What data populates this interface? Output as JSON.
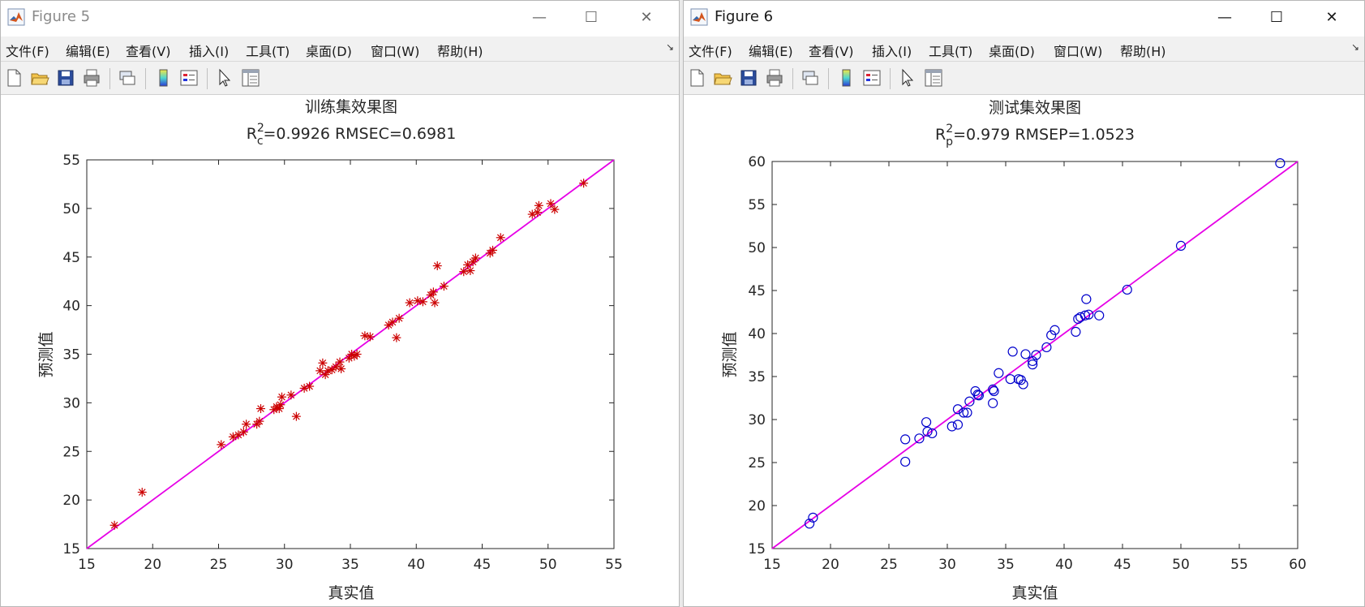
{
  "windows": [
    {
      "title": "Figure 5",
      "active": false,
      "menu": [
        "文件(F)",
        "编辑(E)",
        "查看(V)",
        "插入(I)",
        "工具(T)",
        "桌面(D)",
        "窗口(W)",
        "帮助(H)"
      ],
      "window_buttons": {
        "minimize": "—",
        "maximize": "☐",
        "close": "✕"
      },
      "menu_overflow": "↘",
      "plot": {
        "title": "训练集效果图",
        "subtitle": {
          "r": "R",
          "sup": "2",
          "sub": "c",
          "rest": "=0.9926  RMSEC=0.6981"
        },
        "xlabel": "真实值",
        "ylabel": "预测值"
      }
    },
    {
      "title": "Figure 6",
      "active": true,
      "menu": [
        "文件(F)",
        "编辑(E)",
        "查看(V)",
        "插入(I)",
        "工具(T)",
        "桌面(D)",
        "窗口(W)",
        "帮助(H)"
      ],
      "window_buttons": {
        "minimize": "—",
        "maximize": "☐",
        "close": "✕"
      },
      "menu_overflow": "↘",
      "plot": {
        "title": "测试集效果图",
        "subtitle": {
          "r": "R",
          "sup": "2",
          "sub": "p",
          "rest": "=0.979  RMSEP=1.0523"
        },
        "xlabel": "真实值",
        "ylabel": "预测值"
      }
    }
  ],
  "chart_data": [
    {
      "type": "scatter",
      "title": "训练集效果图",
      "subtitle": "R_c^2=0.9926  RMSEC=0.6981",
      "xlabel": "真实值",
      "ylabel": "预测值",
      "xlim": [
        15,
        55
      ],
      "ylim": [
        15,
        55
      ],
      "xticks": [
        15,
        20,
        25,
        30,
        35,
        40,
        45,
        50,
        55
      ],
      "yticks": [
        15,
        20,
        25,
        30,
        35,
        40,
        45,
        50,
        55
      ],
      "marker": "asterisk",
      "marker_color": "#cc0000",
      "line_color": "#e600e6",
      "fit_line": [
        [
          15,
          15
        ],
        [
          55,
          55
        ]
      ],
      "points": [
        [
          17.1,
          17.4
        ],
        [
          19.2,
          20.8
        ],
        [
          25.2,
          25.7
        ],
        [
          26.1,
          26.5
        ],
        [
          26.5,
          26.7
        ],
        [
          26.9,
          27.0
        ],
        [
          27.1,
          27.8
        ],
        [
          27.9,
          27.8
        ],
        [
          28.1,
          28.1
        ],
        [
          28.2,
          29.4
        ],
        [
          29.2,
          29.3
        ],
        [
          29.4,
          29.6
        ],
        [
          29.6,
          29.4
        ],
        [
          29.7,
          29.8
        ],
        [
          29.8,
          30.6
        ],
        [
          30.5,
          30.8
        ],
        [
          30.9,
          28.6
        ],
        [
          31.5,
          31.5
        ],
        [
          31.9,
          31.7
        ],
        [
          32.7,
          33.3
        ],
        [
          32.9,
          34.1
        ],
        [
          33.1,
          32.9
        ],
        [
          33.3,
          33.3
        ],
        [
          33.6,
          33.4
        ],
        [
          33.9,
          33.7
        ],
        [
          34.2,
          34.2
        ],
        [
          34.3,
          33.5
        ],
        [
          34.9,
          34.6
        ],
        [
          35.1,
          35.0
        ],
        [
          35.3,
          34.8
        ],
        [
          35.5,
          35.0
        ],
        [
          36.1,
          36.9
        ],
        [
          36.5,
          36.8
        ],
        [
          37.9,
          38.0
        ],
        [
          38.2,
          38.3
        ],
        [
          38.5,
          36.7
        ],
        [
          38.7,
          38.7
        ],
        [
          39.5,
          40.3
        ],
        [
          40.1,
          40.5
        ],
        [
          40.5,
          40.4
        ],
        [
          41.1,
          41.1
        ],
        [
          41.3,
          41.4
        ],
        [
          41.4,
          40.3
        ],
        [
          41.6,
          44.1
        ],
        [
          42.1,
          42.0
        ],
        [
          43.6,
          43.5
        ],
        [
          43.9,
          44.2
        ],
        [
          44.1,
          43.6
        ],
        [
          44.3,
          44.5
        ],
        [
          44.5,
          44.9
        ],
        [
          45.6,
          45.4
        ],
        [
          45.8,
          45.7
        ],
        [
          46.4,
          47.0
        ],
        [
          48.8,
          49.4
        ],
        [
          49.2,
          49.6
        ],
        [
          49.3,
          50.3
        ],
        [
          50.2,
          50.5
        ],
        [
          50.5,
          49.9
        ],
        [
          52.7,
          52.6
        ]
      ]
    },
    {
      "type": "scatter",
      "title": "测试集效果图",
      "subtitle": "R_p^2=0.979  RMSEP=1.0523",
      "xlabel": "真实值",
      "ylabel": "预测值",
      "xlim": [
        15,
        60
      ],
      "ylim": [
        15,
        60
      ],
      "xticks": [
        15,
        20,
        25,
        30,
        35,
        40,
        45,
        50,
        55,
        60
      ],
      "yticks": [
        15,
        20,
        25,
        30,
        35,
        40,
        45,
        50,
        55,
        60
      ],
      "marker": "circle",
      "marker_color": "#0000cc",
      "line_color": "#e600e6",
      "fit_line": [
        [
          15,
          15
        ],
        [
          60,
          60
        ]
      ],
      "points": [
        [
          18.2,
          17.9
        ],
        [
          18.5,
          18.6
        ],
        [
          26.4,
          27.7
        ],
        [
          26.4,
          25.1
        ],
        [
          27.6,
          27.8
        ],
        [
          28.2,
          29.7
        ],
        [
          28.3,
          28.6
        ],
        [
          28.7,
          28.4
        ],
        [
          30.4,
          29.2
        ],
        [
          30.9,
          31.2
        ],
        [
          30.9,
          29.4
        ],
        [
          31.4,
          30.8
        ],
        [
          31.7,
          30.8
        ],
        [
          31.9,
          32.1
        ],
        [
          32.4,
          33.3
        ],
        [
          32.6,
          32.9
        ],
        [
          32.7,
          32.8
        ],
        [
          33.9,
          33.5
        ],
        [
          33.9,
          31.9
        ],
        [
          34.0,
          33.3
        ],
        [
          34.4,
          35.4
        ],
        [
          35.4,
          34.7
        ],
        [
          35.6,
          37.9
        ],
        [
          36.1,
          34.7
        ],
        [
          36.3,
          34.6
        ],
        [
          36.5,
          34.1
        ],
        [
          36.7,
          37.6
        ],
        [
          37.3,
          36.4
        ],
        [
          37.3,
          36.8
        ],
        [
          37.6,
          37.5
        ],
        [
          38.5,
          38.4
        ],
        [
          38.9,
          39.8
        ],
        [
          39.2,
          40.4
        ],
        [
          41.0,
          40.2
        ],
        [
          41.2,
          41.7
        ],
        [
          41.4,
          41.9
        ],
        [
          41.8,
          42.1
        ],
        [
          41.9,
          44.0
        ],
        [
          42.1,
          42.2
        ],
        [
          43.0,
          42.1
        ],
        [
          45.4,
          45.1
        ],
        [
          50.0,
          50.2
        ],
        [
          58.5,
          59.8
        ]
      ]
    }
  ]
}
